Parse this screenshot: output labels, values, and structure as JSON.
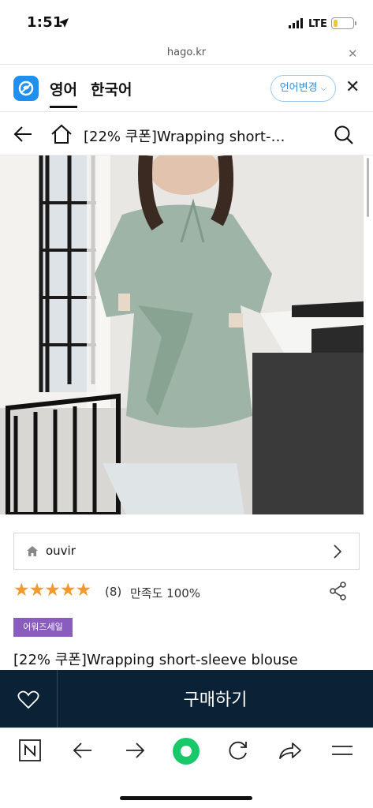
{
  "status": {
    "time": "1:51",
    "network": "LTE",
    "battery_fill": 0.25
  },
  "browser": {
    "url": "hago.kr"
  },
  "lang_bar": {
    "tab_english": "영어",
    "tab_korean": "한국어",
    "change_label": "언어변경"
  },
  "nav": {
    "title": "[22% 쿠폰]Wrapping short-…"
  },
  "seller": {
    "name": "ouvir"
  },
  "rating": {
    "stars": "★★★★★",
    "review_count": "(8)",
    "satisfaction": "만족도 100%"
  },
  "badge": {
    "label": "어워즈세일"
  },
  "product": {
    "title": "[22% 쿠폰]Wrapping short-sleeve blouse"
  },
  "buy_bar": {
    "buy_label": "구매하기"
  },
  "colors": {
    "accent_navy": "#0b2236",
    "star_orange": "#f29a2e",
    "badge_purple": "#8a5cc0",
    "hago_blue": "#1f8ff0"
  },
  "icons": [
    "location-arrow-icon",
    "signal-icon",
    "battery-icon",
    "close-icon",
    "hago-logo-icon",
    "back-arrow-icon",
    "home-icon",
    "search-icon",
    "chevron-right-icon",
    "share-icon",
    "heart-icon",
    "naver-icon",
    "reload-icon",
    "forward-share-icon",
    "menu-icon"
  ]
}
